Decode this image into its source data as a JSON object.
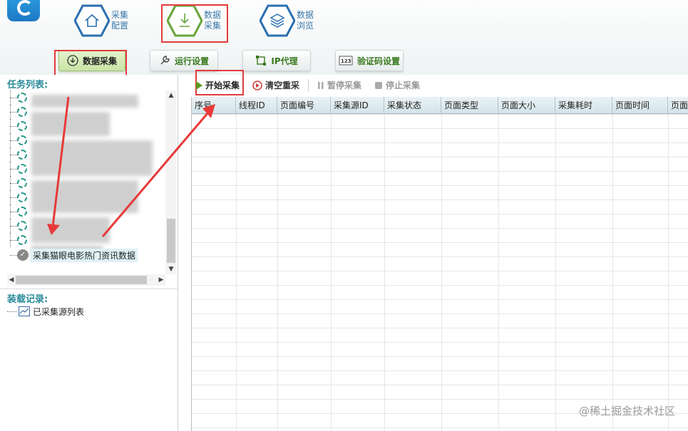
{
  "top_nav": [
    {
      "line1": "采集",
      "line2": "配置"
    },
    {
      "line1": "数据",
      "line2": "采集"
    },
    {
      "line1": "数据",
      "line2": "浏览"
    }
  ],
  "sub_tabs": [
    "数据采集",
    "运行设置",
    "IP代理",
    "验证码设置"
  ],
  "left": {
    "task_title": "任务列表:",
    "selected_task": "采集猫眼电影热门资讯数据",
    "record_title": "装载记录:",
    "record_item": "已采集源列表"
  },
  "toolbar": [
    "开始采集",
    "清空重采",
    "暂停采集",
    "停止采集"
  ],
  "table": {
    "columns": [
      "序号",
      "线程ID",
      "页面编号",
      "采集源ID",
      "采集状态",
      "页面类型",
      "页面大小",
      "采集耗时",
      "页面时间",
      "页面"
    ]
  },
  "watermark": "@稀土掘金技术社区",
  "colors": {
    "highlight": "#e23b3b",
    "accent": "#3a7a1f",
    "title": "#2a8a9a"
  }
}
